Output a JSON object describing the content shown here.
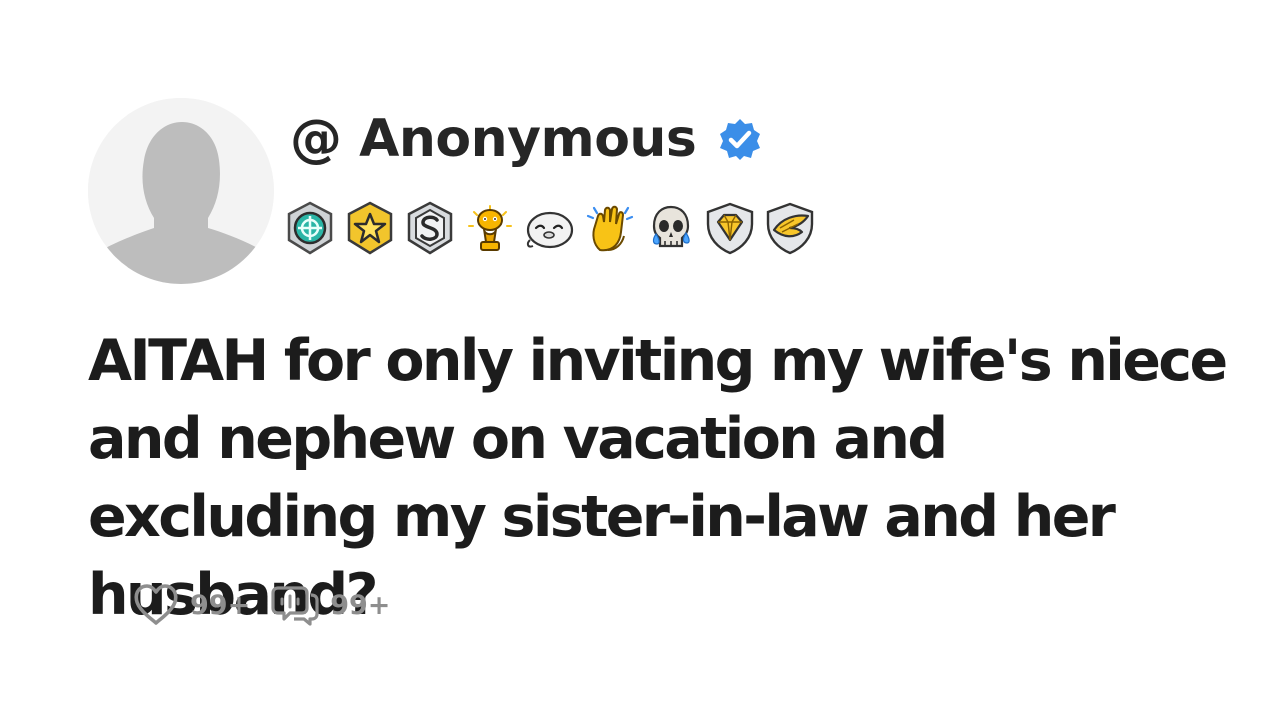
{
  "post": {
    "author": {
      "handle": "@ Anonymous",
      "avatar_icon": "default-user-silhouette-icon",
      "verified_icon": "verified-check-icon",
      "verified_color": "#3b8ee8"
    },
    "badges": [
      {
        "name": "teal-compass-badge-icon"
      },
      {
        "name": "gold-star-badge-icon"
      },
      {
        "name": "silver-s-badge-icon"
      },
      {
        "name": "golden-trophy-badge-icon"
      },
      {
        "name": "smiling-seal-badge-icon"
      },
      {
        "name": "clapping-hands-badge-icon"
      },
      {
        "name": "crying-skull-badge-icon"
      },
      {
        "name": "diamond-shield-badge-icon"
      },
      {
        "name": "winged-shield-badge-icon"
      }
    ],
    "title": "AITAH for only inviting my wife's niece and nephew on vacation and excluding my sister-in-law and her husband?",
    "stats": {
      "likes": "99+",
      "comments": "99+",
      "like_icon": "heart-icon",
      "comment_icon": "comment-icon"
    }
  }
}
